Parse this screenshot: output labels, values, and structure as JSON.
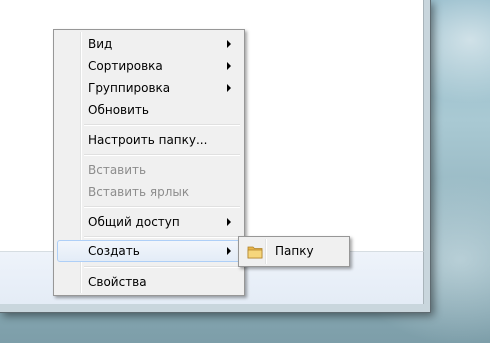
{
  "context_menu": {
    "items": [
      {
        "label": "Вид",
        "submenu": true,
        "enabled": true
      },
      {
        "label": "Сортировка",
        "submenu": true,
        "enabled": true
      },
      {
        "label": "Группировка",
        "submenu": true,
        "enabled": true
      },
      {
        "label": "Обновить",
        "submenu": false,
        "enabled": true
      },
      {
        "label": "Настроить папку...",
        "submenu": false,
        "enabled": true
      },
      {
        "label": "Вставить",
        "submenu": false,
        "enabled": false
      },
      {
        "label": "Вставить ярлык",
        "submenu": false,
        "enabled": false
      },
      {
        "label": "Общий доступ",
        "submenu": true,
        "enabled": true
      },
      {
        "label": "Создать",
        "submenu": true,
        "enabled": true,
        "highlighted": true
      },
      {
        "label": "Свойства",
        "submenu": false,
        "enabled": true
      }
    ]
  },
  "submenu": {
    "items": [
      {
        "label": "Папку",
        "icon": "folder-icon"
      }
    ]
  },
  "colors": {
    "menu_bg": "#f0f0f0",
    "highlight_border": "#aecff7",
    "disabled_text": "#8d8d8d"
  }
}
